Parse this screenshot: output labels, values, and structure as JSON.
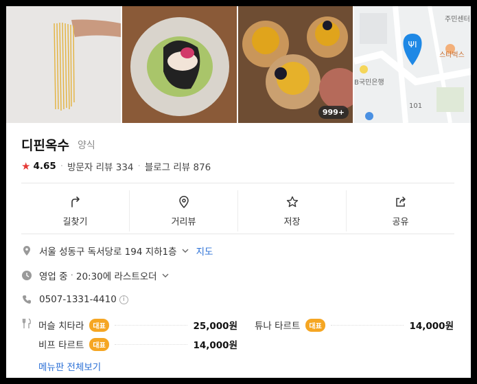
{
  "photos": {
    "count_badge": "999+",
    "map_labels": [
      "주민센터",
      "스타벅스",
      "B국민은행",
      "101"
    ]
  },
  "place": {
    "name": "디핀옥수",
    "category": "양식",
    "rating": "4.65",
    "visitor_review": "방문자 리뷰 334",
    "blog_review": "블로그 리뷰 876"
  },
  "actions": [
    {
      "label": "길찾기",
      "icon": "directions-icon"
    },
    {
      "label": "거리뷰",
      "icon": "streetview-pin-icon"
    },
    {
      "label": "저장",
      "icon": "star-outline-icon"
    },
    {
      "label": "공유",
      "icon": "share-icon"
    }
  ],
  "info": {
    "address": "서울 성동구 독서당로 194 지하1층",
    "map_link": "지도",
    "status": "영업 중",
    "status_detail": "20:30에 라스트오더",
    "phone": "0507-1331-4410",
    "info_mark": "i"
  },
  "menu": {
    "badge": "대표",
    "items": [
      {
        "name": "머슬 치타라",
        "price": "25,000원"
      },
      {
        "name": "튜나 타르트",
        "price": "14,000원"
      },
      {
        "name": "비프 타르트",
        "price": "14,000원"
      }
    ],
    "view_all": "메뉴판 전체보기"
  },
  "colors": {
    "accent_link": "#2a6fd6",
    "star": "#e53935",
    "badge_orange": "#f5a623",
    "map_pin": "#1e88e5"
  }
}
